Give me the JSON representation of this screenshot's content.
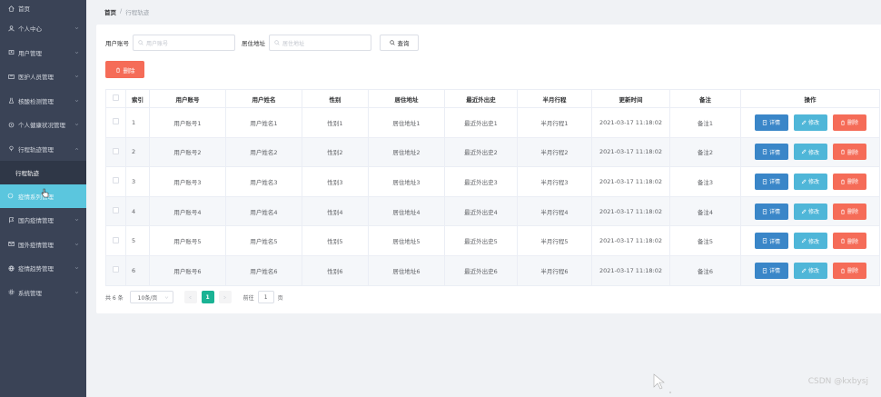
{
  "sidebar": {
    "items": [
      {
        "label": "首页",
        "icon": "home-icon"
      },
      {
        "label": "个人中心",
        "icon": "user-icon"
      },
      {
        "label": "用户管理",
        "icon": "users-icon"
      },
      {
        "label": "医护人员管理",
        "icon": "id-card-icon"
      },
      {
        "label": "核酸检测管理",
        "icon": "flask-icon"
      },
      {
        "label": "个人健康状况管理",
        "icon": "heart-icon"
      },
      {
        "label": "行程轨迹管理",
        "icon": "route-icon"
      }
    ],
    "sub_items": [
      {
        "label": "行程轨迹"
      },
      {
        "label": "疫情系列管理"
      }
    ],
    "items_after": [
      {
        "label": "国内疫情管理",
        "icon": "flag-icon"
      },
      {
        "label": "国外疫情管理",
        "icon": "mail-icon"
      },
      {
        "label": "疫情趋势管理",
        "icon": "globe-icon"
      },
      {
        "label": "系统管理",
        "icon": "gear-icon"
      }
    ]
  },
  "breadcrumb": {
    "home": "首页",
    "separator": "/",
    "current": "行程轨迹"
  },
  "filters": {
    "account_label": "用户账号",
    "account_placeholder": "用户账号",
    "address_label": "居住地址",
    "address_placeholder": "居住地址",
    "search_label": "查询"
  },
  "toolbar": {
    "delete_label": "删除"
  },
  "table": {
    "headers": [
      "索引",
      "用户账号",
      "用户姓名",
      "性别",
      "居住地址",
      "最近外出史",
      "半月行程",
      "更新时间",
      "备注",
      "操作"
    ],
    "rows": [
      {
        "idx": "1",
        "account": "用户账号1",
        "name": "用户姓名1",
        "gender": "性别1",
        "address": "居住地址1",
        "outing": "最近外出史1",
        "trip": "半月行程1",
        "time": "2021-03-17 11:18:02",
        "note": "备注1"
      },
      {
        "idx": "2",
        "account": "用户账号2",
        "name": "用户姓名2",
        "gender": "性别2",
        "address": "居住地址2",
        "outing": "最近外出史2",
        "trip": "半月行程2",
        "time": "2021-03-17 11:18:02",
        "note": "备注2"
      },
      {
        "idx": "3",
        "account": "用户账号3",
        "name": "用户姓名3",
        "gender": "性别3",
        "address": "居住地址3",
        "outing": "最近外出史3",
        "trip": "半月行程3",
        "time": "2021-03-17 11:18:02",
        "note": "备注3"
      },
      {
        "idx": "4",
        "account": "用户账号4",
        "name": "用户姓名4",
        "gender": "性别4",
        "address": "居住地址4",
        "outing": "最近外出史4",
        "trip": "半月行程4",
        "time": "2021-03-17 11:18:02",
        "note": "备注4"
      },
      {
        "idx": "5",
        "account": "用户账号5",
        "name": "用户姓名5",
        "gender": "性别5",
        "address": "居住地址5",
        "outing": "最近外出史5",
        "trip": "半月行程5",
        "time": "2021-03-17 11:18:02",
        "note": "备注5"
      },
      {
        "idx": "6",
        "account": "用户账号6",
        "name": "用户姓名6",
        "gender": "性别6",
        "address": "居住地址6",
        "outing": "最近外出史6",
        "trip": "半月行程6",
        "time": "2021-03-17 11:18:02",
        "note": "备注6"
      }
    ],
    "actions": {
      "detail": "详情",
      "edit": "修改",
      "delete": "删除"
    }
  },
  "pagination": {
    "total": "共 6 条",
    "page_size": "10条/页",
    "current_page": "1",
    "goto_label": "前往",
    "goto_value": "1",
    "page_suffix": "页"
  },
  "watermark": "CSDN @kxbysj",
  "colors": {
    "sidebar_bg": "#3a4356",
    "active_item": "#5bc6de",
    "danger": "#f56c58",
    "primary": "#3a86c8",
    "info": "#4fb6d8",
    "page_active": "#1ab394"
  }
}
